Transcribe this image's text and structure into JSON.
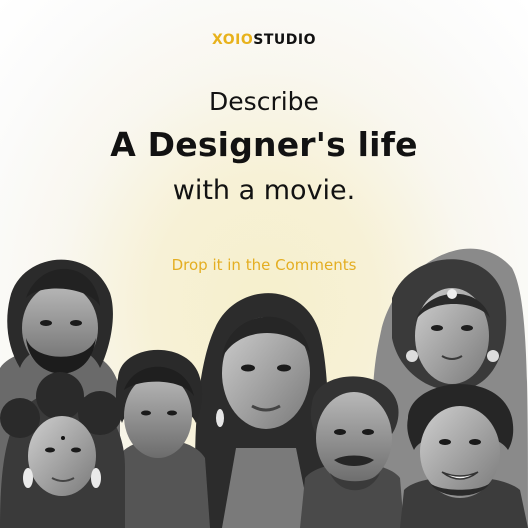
{
  "logo": {
    "brand_part1": "XOIO",
    "brand_part2": "STUDIO",
    "accent_color": "#e8b21c"
  },
  "headline": {
    "line1": "Describe",
    "line2": "A Designer's life",
    "line3": "with a movie."
  },
  "cta": {
    "text": "Drop it in the Comments"
  },
  "illustration": {
    "name": "celebrity-portrait-collage",
    "style": "grayscale"
  }
}
